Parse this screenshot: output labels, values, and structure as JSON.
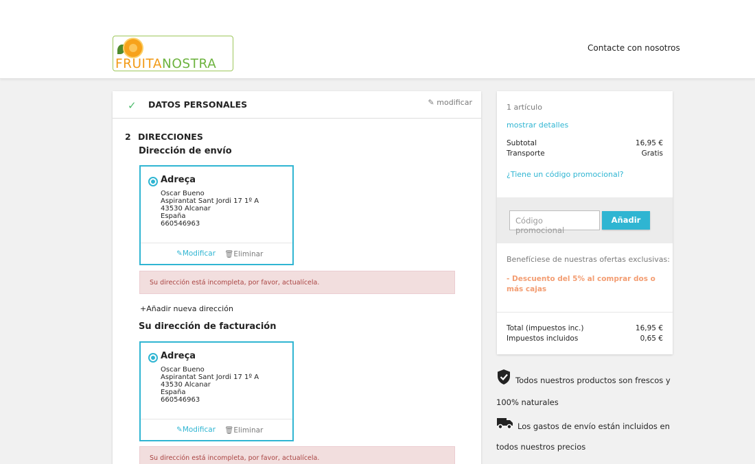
{
  "header": {
    "logo_part1": "FRUITA",
    "logo_part2": "NOSTRA",
    "contact_link": "Contacte con nosotros"
  },
  "checkout": {
    "step1": {
      "check_icon": "check-icon",
      "title": "DATOS PERSONALES",
      "edit_label": "modificar"
    },
    "step2": {
      "number": "2",
      "title": "DIRECCIONES",
      "shipping_heading": "Dirección de envío",
      "billing_heading": "Su dirección de facturación",
      "add_new": "Añadir nueva dirección",
      "shipping_address": {
        "alias": "Adreça",
        "name": "Oscar Bueno",
        "street": "Aspirantat Sant Jordi 17 1º A",
        "city": "43530 Alcanar",
        "country": "España",
        "phone": "660546963",
        "edit_label": "Modificar",
        "delete_label": "Eliminar"
      },
      "billing_address": {
        "alias": "Adreça",
        "name": "Oscar Bueno",
        "street": "Aspirantat Sant Jordi 17 1º A",
        "city": "43530 Alcanar",
        "country": "España",
        "phone": "660546963",
        "edit_label": "Modificar",
        "delete_label": "Eliminar"
      },
      "incomplete_alert": "Su dirección está incompleta, por favor, actualícela."
    }
  },
  "summary": {
    "item_count": "1 artículo",
    "show_details": "mostrar detalles",
    "subtotal_label": "Subtotal",
    "subtotal_value": "16,95 €",
    "shipping_label": "Transporte",
    "shipping_value": "Gratis",
    "promo_link": "¿Tiene un código promocional?",
    "promo_placeholder": "Código promocional",
    "promo_button": "Añadir",
    "benefit_text": "Benefíciese de nuestras ofertas exclusivas:",
    "discount_text": "- Descuento del 5% al comprar dos o más cajas",
    "total_label": "Total (impuestos inc.)",
    "total_value": "16,95 €",
    "taxes_label": "Impuestos incluidos",
    "taxes_value": "0,65 €"
  },
  "reassurance": [
    {
      "icon": "shield-check-icon",
      "text": "Todos nuestros productos son frescos y 100% naturales"
    },
    {
      "icon": "truck-icon",
      "text": "Los gastos de envío están incluidos en todos nuestros precios"
    }
  ],
  "colors": {
    "accent": "#2fb5d2",
    "alert_bg": "#f2dede",
    "discount": "#f39d72"
  }
}
